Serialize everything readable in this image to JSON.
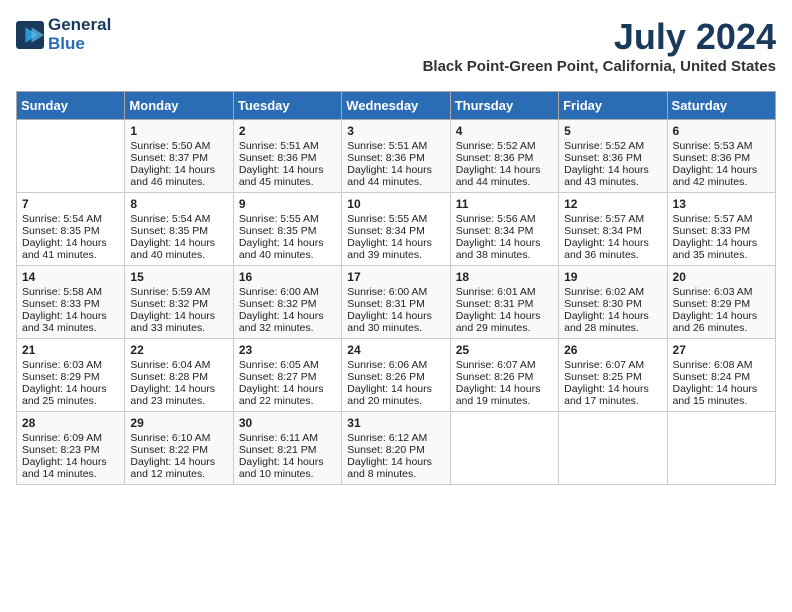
{
  "header": {
    "logo_line1": "General",
    "logo_line2": "Blue",
    "main_title": "July 2024",
    "subtitle": "Black Point-Green Point, California, United States"
  },
  "calendar": {
    "days_of_week": [
      "Sunday",
      "Monday",
      "Tuesday",
      "Wednesday",
      "Thursday",
      "Friday",
      "Saturday"
    ],
    "weeks": [
      [
        {
          "day": "",
          "content": ""
        },
        {
          "day": "1",
          "content": "Sunrise: 5:50 AM\nSunset: 8:37 PM\nDaylight: 14 hours\nand 46 minutes."
        },
        {
          "day": "2",
          "content": "Sunrise: 5:51 AM\nSunset: 8:36 PM\nDaylight: 14 hours\nand 45 minutes."
        },
        {
          "day": "3",
          "content": "Sunrise: 5:51 AM\nSunset: 8:36 PM\nDaylight: 14 hours\nand 44 minutes."
        },
        {
          "day": "4",
          "content": "Sunrise: 5:52 AM\nSunset: 8:36 PM\nDaylight: 14 hours\nand 44 minutes."
        },
        {
          "day": "5",
          "content": "Sunrise: 5:52 AM\nSunset: 8:36 PM\nDaylight: 14 hours\nand 43 minutes."
        },
        {
          "day": "6",
          "content": "Sunrise: 5:53 AM\nSunset: 8:36 PM\nDaylight: 14 hours\nand 42 minutes."
        }
      ],
      [
        {
          "day": "7",
          "content": "Sunrise: 5:54 AM\nSunset: 8:35 PM\nDaylight: 14 hours\nand 41 minutes."
        },
        {
          "day": "8",
          "content": "Sunrise: 5:54 AM\nSunset: 8:35 PM\nDaylight: 14 hours\nand 40 minutes."
        },
        {
          "day": "9",
          "content": "Sunrise: 5:55 AM\nSunset: 8:35 PM\nDaylight: 14 hours\nand 40 minutes."
        },
        {
          "day": "10",
          "content": "Sunrise: 5:55 AM\nSunset: 8:34 PM\nDaylight: 14 hours\nand 39 minutes."
        },
        {
          "day": "11",
          "content": "Sunrise: 5:56 AM\nSunset: 8:34 PM\nDaylight: 14 hours\nand 38 minutes."
        },
        {
          "day": "12",
          "content": "Sunrise: 5:57 AM\nSunset: 8:34 PM\nDaylight: 14 hours\nand 36 minutes."
        },
        {
          "day": "13",
          "content": "Sunrise: 5:57 AM\nSunset: 8:33 PM\nDaylight: 14 hours\nand 35 minutes."
        }
      ],
      [
        {
          "day": "14",
          "content": "Sunrise: 5:58 AM\nSunset: 8:33 PM\nDaylight: 14 hours\nand 34 minutes."
        },
        {
          "day": "15",
          "content": "Sunrise: 5:59 AM\nSunset: 8:32 PM\nDaylight: 14 hours\nand 33 minutes."
        },
        {
          "day": "16",
          "content": "Sunrise: 6:00 AM\nSunset: 8:32 PM\nDaylight: 14 hours\nand 32 minutes."
        },
        {
          "day": "17",
          "content": "Sunrise: 6:00 AM\nSunset: 8:31 PM\nDaylight: 14 hours\nand 30 minutes."
        },
        {
          "day": "18",
          "content": "Sunrise: 6:01 AM\nSunset: 8:31 PM\nDaylight: 14 hours\nand 29 minutes."
        },
        {
          "day": "19",
          "content": "Sunrise: 6:02 AM\nSunset: 8:30 PM\nDaylight: 14 hours\nand 28 minutes."
        },
        {
          "day": "20",
          "content": "Sunrise: 6:03 AM\nSunset: 8:29 PM\nDaylight: 14 hours\nand 26 minutes."
        }
      ],
      [
        {
          "day": "21",
          "content": "Sunrise: 6:03 AM\nSunset: 8:29 PM\nDaylight: 14 hours\nand 25 minutes."
        },
        {
          "day": "22",
          "content": "Sunrise: 6:04 AM\nSunset: 8:28 PM\nDaylight: 14 hours\nand 23 minutes."
        },
        {
          "day": "23",
          "content": "Sunrise: 6:05 AM\nSunset: 8:27 PM\nDaylight: 14 hours\nand 22 minutes."
        },
        {
          "day": "24",
          "content": "Sunrise: 6:06 AM\nSunset: 8:26 PM\nDaylight: 14 hours\nand 20 minutes."
        },
        {
          "day": "25",
          "content": "Sunrise: 6:07 AM\nSunset: 8:26 PM\nDaylight: 14 hours\nand 19 minutes."
        },
        {
          "day": "26",
          "content": "Sunrise: 6:07 AM\nSunset: 8:25 PM\nDaylight: 14 hours\nand 17 minutes."
        },
        {
          "day": "27",
          "content": "Sunrise: 6:08 AM\nSunset: 8:24 PM\nDaylight: 14 hours\nand 15 minutes."
        }
      ],
      [
        {
          "day": "28",
          "content": "Sunrise: 6:09 AM\nSunset: 8:23 PM\nDaylight: 14 hours\nand 14 minutes."
        },
        {
          "day": "29",
          "content": "Sunrise: 6:10 AM\nSunset: 8:22 PM\nDaylight: 14 hours\nand 12 minutes."
        },
        {
          "day": "30",
          "content": "Sunrise: 6:11 AM\nSunset: 8:21 PM\nDaylight: 14 hours\nand 10 minutes."
        },
        {
          "day": "31",
          "content": "Sunrise: 6:12 AM\nSunset: 8:20 PM\nDaylight: 14 hours\nand 8 minutes."
        },
        {
          "day": "",
          "content": ""
        },
        {
          "day": "",
          "content": ""
        },
        {
          "day": "",
          "content": ""
        }
      ]
    ]
  }
}
